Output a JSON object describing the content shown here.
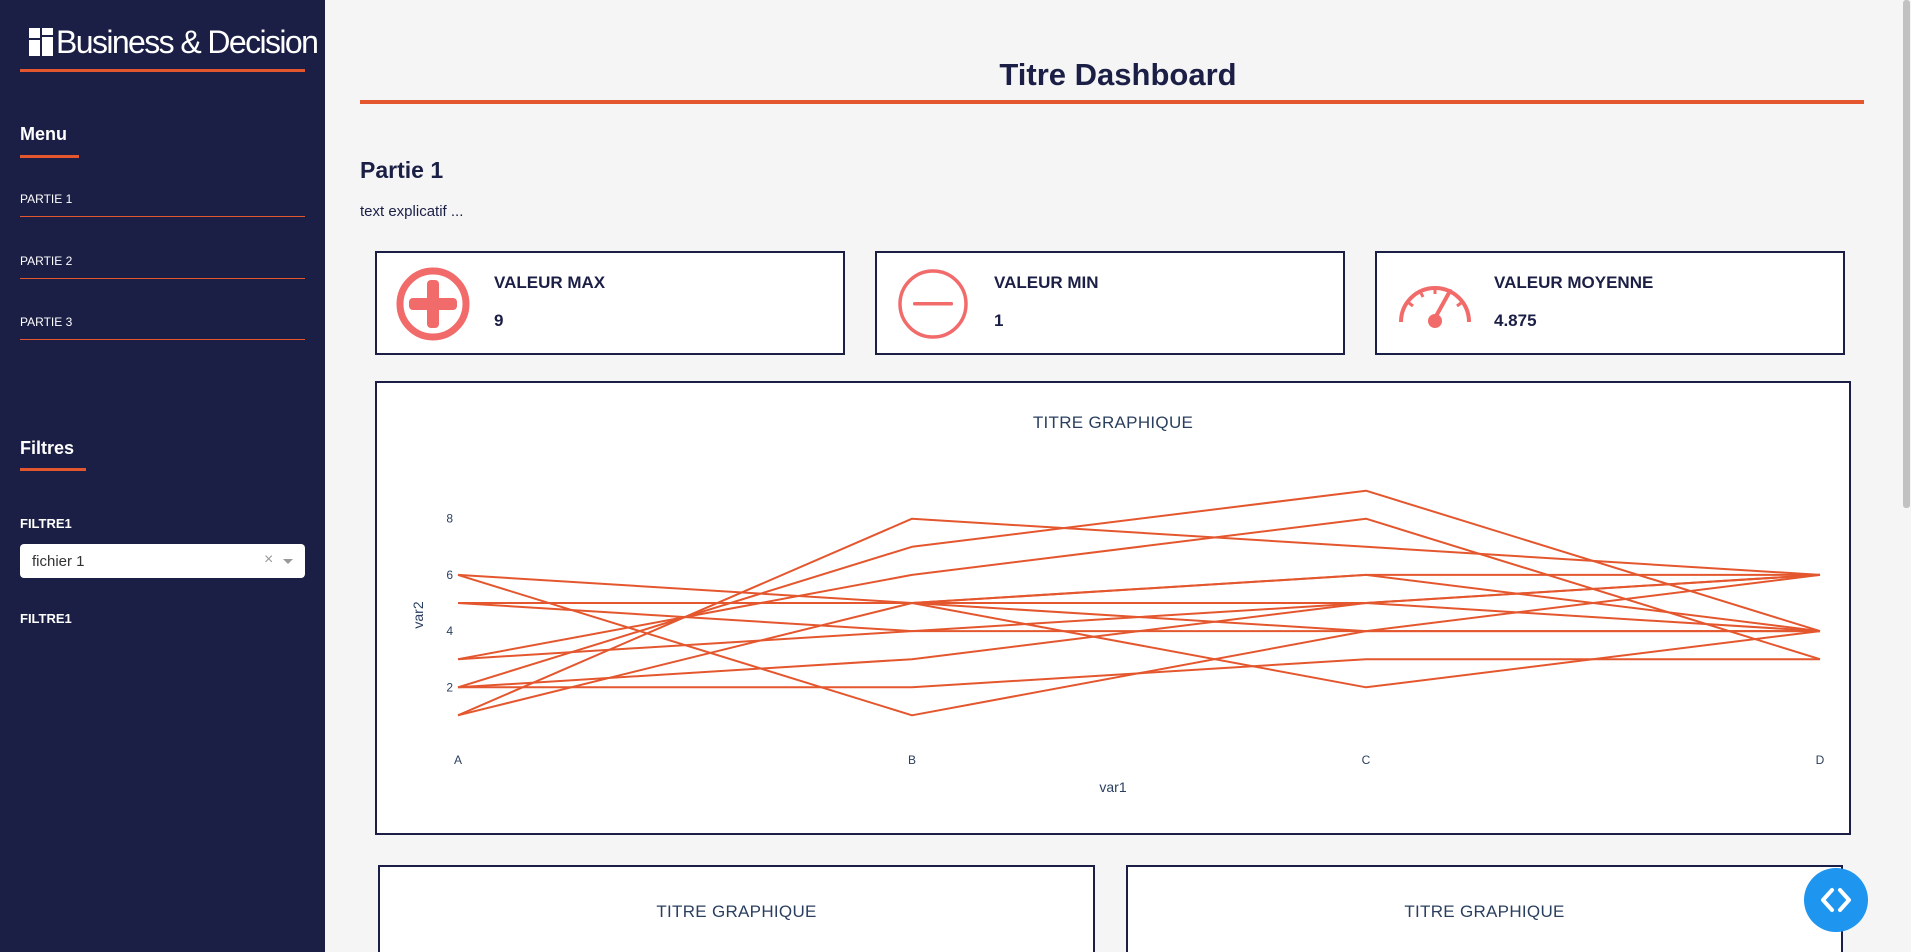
{
  "brand": {
    "logo_text": "Business & Decision",
    "accent": "#e4572e",
    "sidebar_bg": "#1b1f45"
  },
  "sidebar": {
    "menu_title": "Menu",
    "items": [
      {
        "label": "PARTIE 1"
      },
      {
        "label": "PARTIE 2"
      },
      {
        "label": "PARTIE 3"
      }
    ],
    "filters_title": "Filtres",
    "filters": [
      {
        "label": "FILTRE1",
        "value": "fichier 1",
        "clear": "×"
      },
      {
        "label": "FILTRE1"
      }
    ]
  },
  "main": {
    "title": "Titre Dashboard",
    "section_title": "Partie 1",
    "section_text": "text explicatif ...",
    "kpis": [
      {
        "title": "VALEUR MAX",
        "value": "9",
        "icon": "plus-circle-icon"
      },
      {
        "title": "VALEUR MIN",
        "value": "1",
        "icon": "minus-circle-icon"
      },
      {
        "title": "VALEUR MOYENNE",
        "value": "4.875",
        "icon": "gauge-icon"
      }
    ],
    "small_charts": [
      {
        "title": "TITRE GRAPHIQUE"
      },
      {
        "title": "TITRE GRAPHIQUE"
      }
    ]
  },
  "icon_color": "#f26b6b",
  "fab_icon": "code-icon",
  "chart_data": {
    "type": "line",
    "title": "TITRE GRAPHIQUE",
    "xlabel": "var1",
    "ylabel": "var2",
    "categories": [
      "A",
      "B",
      "C",
      "D"
    ],
    "yticks": [
      2,
      4,
      6,
      8
    ],
    "ylim": [
      0.3,
      9.7
    ],
    "color": "#e4572e",
    "series": [
      {
        "values": [
          1,
          8,
          7,
          6
        ]
      },
      {
        "values": [
          2,
          7,
          9,
          4
        ]
      },
      {
        "values": [
          3,
          6,
          8,
          3
        ]
      },
      {
        "values": [
          1,
          5,
          6,
          4
        ]
      },
      {
        "values": [
          6,
          1,
          4,
          6
        ]
      },
      {
        "values": [
          5,
          5,
          2,
          4
        ]
      },
      {
        "values": [
          5,
          5,
          6,
          6
        ]
      },
      {
        "values": [
          6,
          5,
          5,
          6
        ]
      },
      {
        "values": [
          2,
          3,
          5,
          6
        ]
      },
      {
        "values": [
          3,
          4,
          4,
          4
        ]
      },
      {
        "values": [
          5,
          5,
          4,
          4
        ]
      },
      {
        "values": [
          2,
          2,
          3,
          3
        ]
      },
      {
        "values": [
          5,
          4,
          5,
          4
        ]
      }
    ]
  }
}
